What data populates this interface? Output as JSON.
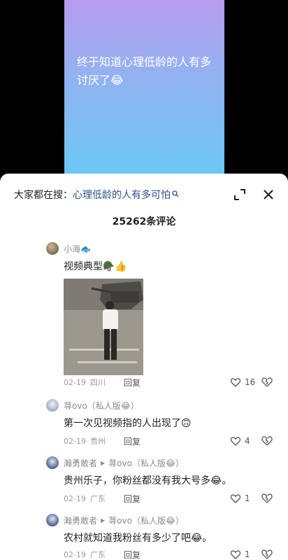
{
  "video": {
    "caption": "终于知道心理低龄的人有多讨厌了😂"
  },
  "sheet": {
    "search_prefix": "大家都在搜：",
    "search_term": "心理低龄的人有多可怕",
    "comment_count": "25262条评论"
  },
  "comments": [
    {
      "name": "小海🐟",
      "text": "视频典型🪖👍",
      "date": "02-19",
      "location": "四川",
      "reply": "回复",
      "likes": "16"
    },
    {
      "name": "荨ovo（私人版😂）",
      "text": "第一次见视频指的人出现了🙃",
      "date": "02-19",
      "location": "贵州",
      "reply": "回复",
      "likes": "4"
    },
    {
      "name": "瀚勇敢者",
      "reply_to": "荨ovo（私人版😂）",
      "text": "贵州乐子，你粉丝都没有我大号多😂。",
      "date": "02-19",
      "location": "广东",
      "reply": "回复",
      "likes": "1"
    },
    {
      "name": "瀚勇敢者",
      "reply_to": "荨ovo（私人版😂）",
      "text": "农村就知道我粉丝有多少了吧😂。",
      "date": "02-19",
      "location": "广东",
      "reply": "回复",
      "likes": "1"
    }
  ],
  "colors": {
    "search_term": "#2b4f8a",
    "meta_gray": "#9a9a9a"
  }
}
